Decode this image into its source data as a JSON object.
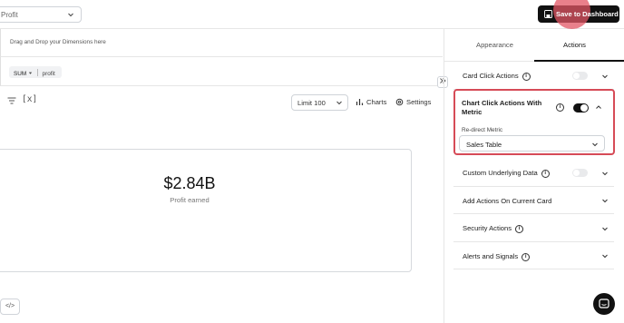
{
  "header": {
    "metric_select_value": "Profit",
    "save_button_label": "Save to Dashboard"
  },
  "builder": {
    "dimensions_placeholder": "Drag and Drop your Dimensions here",
    "measure": {
      "aggregation": "SUM",
      "field": "profit"
    }
  },
  "toolbar": {
    "variables_label": "[x]",
    "limit_label": "Limit",
    "limit_value": "100",
    "charts_label": "Charts",
    "settings_label": "Settings"
  },
  "kpi": {
    "value": "$2.84B",
    "label": "Profit earned"
  },
  "footer": {
    "code_button_label": "</>"
  },
  "panel": {
    "tabs": [
      {
        "label": "Appearance",
        "active": false
      },
      {
        "label": "Actions",
        "active": true
      }
    ],
    "card_click_actions": {
      "label": "Card Click Actions",
      "enabled": false
    },
    "chart_click_actions": {
      "label_line1": "Chart Click Actions With",
      "label_line2": "Metric",
      "enabled": true,
      "redirect_label": "Re-direct Metric",
      "redirect_value": "Sales Table"
    },
    "custom_underlying_data": {
      "label": "Custom Underlying Data",
      "enabled": false
    },
    "sections": [
      {
        "label": "Add Actions On Current Card"
      },
      {
        "label": "Security Actions"
      },
      {
        "label": "Alerts and Signals"
      }
    ]
  },
  "colors": {
    "highlight": "#d64b57",
    "primary": "#111111"
  }
}
